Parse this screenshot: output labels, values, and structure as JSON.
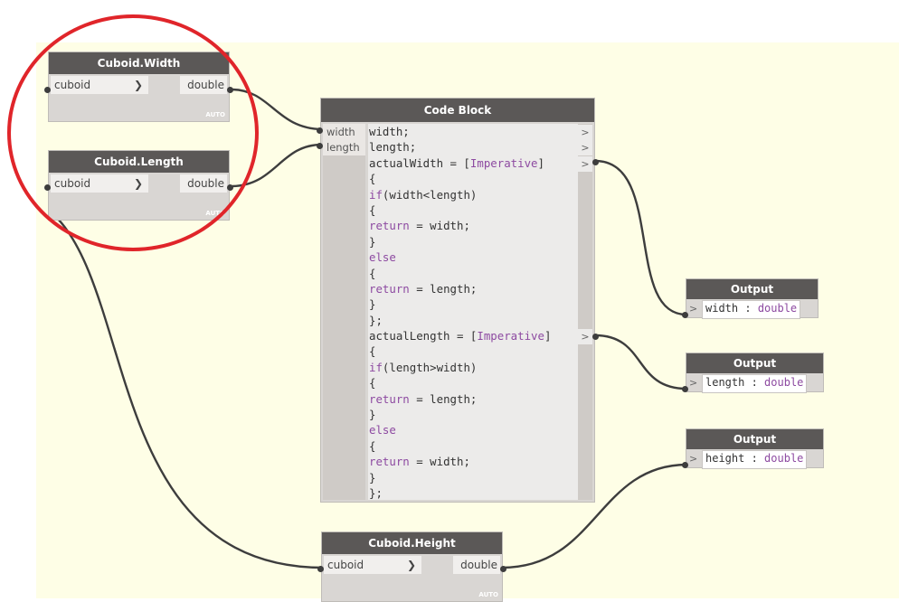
{
  "colors": {
    "canvas": "#fefee6",
    "node_header": "#5b5857",
    "node_body": "#d9d6d3",
    "keyword": "#8d4aa1",
    "wire": "#3d3d3d",
    "highlight": "#e0252a"
  },
  "nodes": {
    "width": {
      "title": "Cuboid.Width",
      "input": "cuboid",
      "output": "double",
      "lacing": "AUTO"
    },
    "length": {
      "title": "Cuboid.Length",
      "input": "cuboid",
      "output": "double",
      "lacing": "AUTO"
    },
    "height": {
      "title": "Cuboid.Height",
      "input": "cuboid",
      "output": "double",
      "lacing": "AUTO"
    }
  },
  "code_block": {
    "title": "Code Block",
    "inputs": [
      "width",
      "length"
    ],
    "lines": [
      "width;",
      "length;",
      "actualWidth = [Imperative]",
      "{",
      "if(width<length)",
      "{",
      "return = width;",
      "}",
      "else",
      "{",
      "return = length;",
      "}",
      "};",
      "actualLength = [Imperative]",
      "{",
      "if(length>width)",
      "{",
      "return = length;",
      "}",
      "else",
      "{",
      "return = width;",
      "}",
      "};"
    ],
    "output_chevron": ">"
  },
  "outputs": [
    {
      "title": "Output",
      "name": "width",
      "sep": " : ",
      "type": "double"
    },
    {
      "title": "Output",
      "name": "length",
      "sep": " : ",
      "type": "double"
    },
    {
      "title": "Output",
      "name": "height",
      "sep": " : ",
      "type": "double"
    }
  ],
  "chevron": ">"
}
